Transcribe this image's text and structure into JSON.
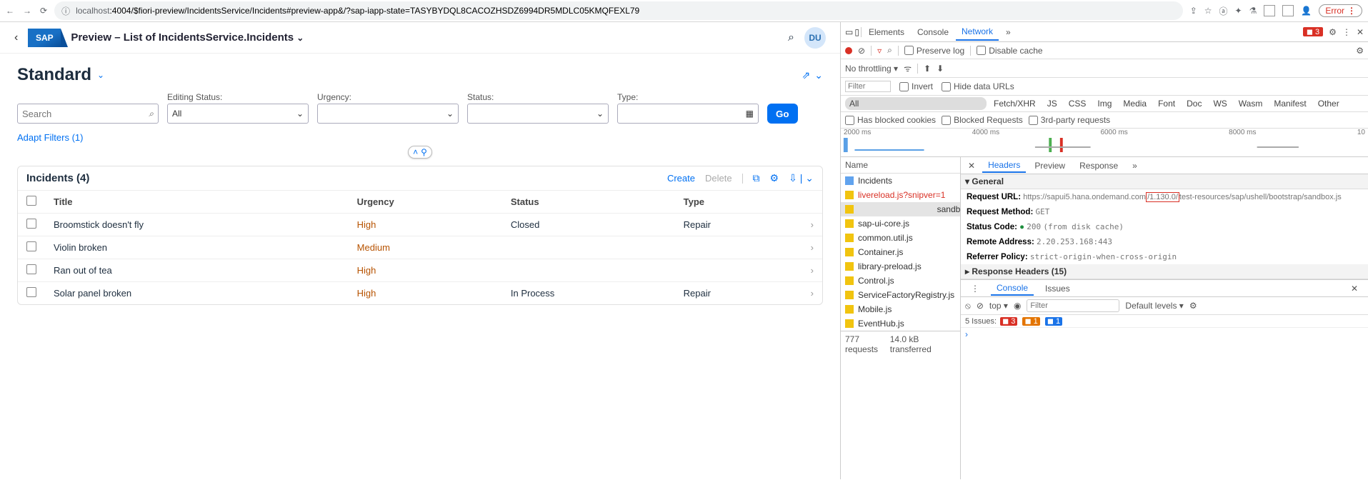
{
  "browser": {
    "url_host": "localhost",
    "url_path": ":4004/$fiori-preview/IncidentsService/Incidents#preview-app&/?sap-iapp-state=TASYBYDQL8CACOZHSDZ6994DR5MDLC05KMQFEXL79",
    "error_label": "Error"
  },
  "shell": {
    "sap_text": "SAP",
    "title": "Preview – List of IncidentsService.Incidents",
    "avatar": "DU"
  },
  "variant": {
    "title": "Standard"
  },
  "filters": {
    "search_placeholder": "Search",
    "editing_status_label": "Editing Status:",
    "editing_status_value": "All",
    "urgency_label": "Urgency:",
    "status_label": "Status:",
    "type_label": "Type:",
    "go_label": "Go",
    "adapt_label": "Adapt Filters (1)"
  },
  "table": {
    "title": "Incidents (4)",
    "create": "Create",
    "delete": "Delete",
    "cols": {
      "title": "Title",
      "urgency": "Urgency",
      "status": "Status",
      "type": "Type"
    },
    "rows": [
      {
        "title": "Broomstick doesn't fly",
        "urgency": "High",
        "urgClass": "urg-high",
        "status": "Closed",
        "type": "Repair"
      },
      {
        "title": "Violin broken",
        "urgency": "Medium",
        "urgClass": "urg-med",
        "status": "",
        "type": ""
      },
      {
        "title": "Ran out of tea",
        "urgency": "High",
        "urgClass": "urg-high",
        "status": "",
        "type": ""
      },
      {
        "title": "Solar panel broken",
        "urgency": "High",
        "urgClass": "urg-high",
        "status": "In Process",
        "type": "Repair"
      }
    ]
  },
  "devtools": {
    "tabs": {
      "elements": "Elements",
      "console": "Console",
      "network": "Network"
    },
    "err_count": "3",
    "preserve_log": "Preserve log",
    "disable_cache": "Disable cache",
    "no_throttling": "No throttling",
    "filter_placeholder": "Filter",
    "invert": "Invert",
    "hide_data": "Hide data URLs",
    "types": [
      "All",
      "Fetch/XHR",
      "JS",
      "CSS",
      "Img",
      "Media",
      "Font",
      "Doc",
      "WS",
      "Wasm",
      "Manifest",
      "Other"
    ],
    "has_blocked": "Has blocked cookies",
    "blocked_req": "Blocked Requests",
    "third_party": "3rd-party requests",
    "timeline_ticks": [
      "2000 ms",
      "4000 ms",
      "6000 ms",
      "8000 ms",
      "10"
    ],
    "name_hdr": "Name",
    "requests": [
      {
        "label": "Incidents",
        "cls": "",
        "icon": "doc"
      },
      {
        "label": "livereload.js?snipver=1",
        "cls": "ws",
        "icon": "js"
      },
      {
        "label": "sandbox.js",
        "cls": "sel",
        "icon": "js"
      },
      {
        "label": "sap-ui-core.js",
        "cls": "",
        "icon": "js"
      },
      {
        "label": "common.util.js",
        "cls": "",
        "icon": "js"
      },
      {
        "label": "Container.js",
        "cls": "",
        "icon": "js"
      },
      {
        "label": "library-preload.js",
        "cls": "",
        "icon": "js"
      },
      {
        "label": "Control.js",
        "cls": "",
        "icon": "js"
      },
      {
        "label": "ServiceFactoryRegistry.js",
        "cls": "",
        "icon": "js"
      },
      {
        "label": "Mobile.js",
        "cls": "",
        "icon": "js"
      },
      {
        "label": "EventHub.js",
        "cls": "",
        "icon": "js"
      }
    ],
    "status_summary": {
      "requests": "777 requests",
      "transferred": "14.0 kB transferred"
    },
    "detail_tabs": {
      "headers": "Headers",
      "preview": "Preview",
      "response": "Response"
    },
    "general": "General",
    "req_url_label": "Request URL:",
    "req_url_pre": "https://sapui5.hana.ondemand.com",
    "req_url_hl": "/1.130.0/",
    "req_url_post": "test-resources/sap/ushell/bootstrap/sandbox.js",
    "req_method_label": "Request Method:",
    "req_method": "GET",
    "status_code_label": "Status Code:",
    "status_code": "200",
    "status_extra": "(from disk cache)",
    "remote_label": "Remote Address:",
    "remote": "2.20.253.168:443",
    "referrer_label": "Referrer Policy:",
    "referrer": "strict-origin-when-cross-origin",
    "resp_headers": "Response Headers (15)",
    "drawer": {
      "console": "Console",
      "issues": "Issues",
      "top": "top",
      "default_levels": "Default levels",
      "filter_placeholder": "Filter",
      "issues_line": "5 Issues:",
      "n_red": "3",
      "n_orn": "1",
      "n_blu": "1",
      "prompt": "›"
    }
  }
}
